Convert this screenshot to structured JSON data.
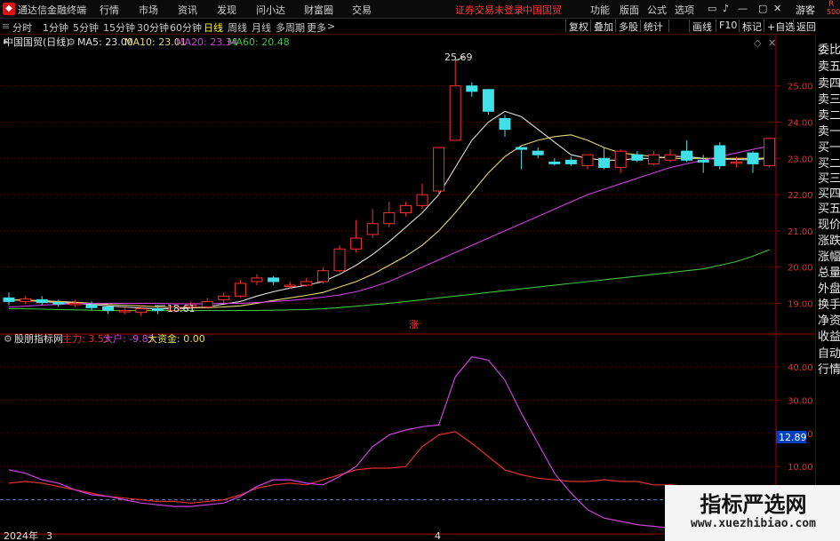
{
  "app": {
    "title": "通达信金融终端",
    "menu": [
      "行情",
      "市场",
      "资讯",
      "发现",
      "问小达",
      "财富圈",
      "交易"
    ],
    "notice": "证券交易未登录",
    "stock_name": "中国国贸",
    "right_menu": [
      "功能",
      "版面",
      "公式",
      "选项"
    ],
    "guest": "游客",
    "corner_top": "R",
    "corner_bottom": "500"
  },
  "periods": {
    "items": [
      "分时",
      "1分钟",
      "5分钟",
      "15分钟",
      "30分钟",
      "60分钟",
      "日线",
      "周线",
      "月线",
      "多周期",
      "更多"
    ],
    "active": "日线"
  },
  "toolbar": [
    "复权",
    "叠加",
    "多股",
    "统计",
    "画线",
    "F10",
    "标记",
    "+自选",
    "返回"
  ],
  "side_panel": [
    "委比",
    "卖五",
    "卖四",
    "卖三",
    "卖二",
    "卖一",
    "买一",
    "买二",
    "买三",
    "买四",
    "买五",
    "现价",
    "涨跌",
    "涨幅",
    "总量",
    "外盘",
    "换手",
    "净资",
    "收益",
    "自动",
    "行情"
  ],
  "main_legend": {
    "title": "中国国贸(日线)",
    "items": [
      {
        "label": "MA5: 23.00",
        "color": "#e0e0e0"
      },
      {
        "label": "MA10: 23.01",
        "color": "#e8d870"
      },
      {
        "label": "MA20: 23.34",
        "color": "#d040e0"
      },
      {
        "label": "MA60: 20.48",
        "color": "#40c040"
      }
    ],
    "high_label": "25.69",
    "low_label": "18.61",
    "rise_mark": "涨"
  },
  "sub_legend": {
    "title": "股朋指标网",
    "items": [
      {
        "label": "主力: 3.53",
        "color": "#e03030"
      },
      {
        "label": "大户: -9.83",
        "color": "#d040e0"
      },
      {
        "label": "大资金: 0.00",
        "color": "#e8e040"
      }
    ],
    "current_value": "12.89"
  },
  "time_axis": {
    "year": "2024年",
    "labels": [
      "3",
      "4"
    ]
  },
  "watermark": {
    "line1": "指标严选网",
    "line2": "www.xuezhibiao.com"
  },
  "colors": {
    "up": "#ff3030",
    "down": "#40e0e8",
    "axis": "#a00000"
  },
  "chart_data": [
    {
      "type": "candlestick",
      "title": "中国国贸(日线)",
      "ylim": [
        18.3,
        25.9
      ],
      "yticks": [
        19.0,
        20.0,
        21.0,
        22.0,
        23.0,
        24.0,
        25.0
      ],
      "candles": [
        [
          19.15,
          19.05,
          19.3,
          18.95
        ],
        [
          19.05,
          19.12,
          19.2,
          18.98
        ],
        [
          19.1,
          19.02,
          19.2,
          18.95
        ],
        [
          19.02,
          18.98,
          19.1,
          18.9
        ],
        [
          18.98,
          19.0,
          19.1,
          18.9
        ],
        [
          18.95,
          18.88,
          19.05,
          18.8
        ],
        [
          18.9,
          18.8,
          18.95,
          18.7
        ],
        [
          18.8,
          18.8,
          18.9,
          18.7
        ],
        [
          18.75,
          18.85,
          18.95,
          18.65
        ],
        [
          18.85,
          18.8,
          18.95,
          18.7
        ],
        [
          18.8,
          18.9,
          18.98,
          18.75
        ],
        [
          18.9,
          18.95,
          19.05,
          18.85
        ],
        [
          18.9,
          19.05,
          19.15,
          18.85
        ],
        [
          19.1,
          19.2,
          19.3,
          19.0
        ],
        [
          19.2,
          19.55,
          19.65,
          19.15
        ],
        [
          19.6,
          19.7,
          19.8,
          19.5
        ],
        [
          19.7,
          19.6,
          19.75,
          19.5
        ],
        [
          19.5,
          19.5,
          19.6,
          19.4
        ],
        [
          19.5,
          19.6,
          19.7,
          19.45
        ],
        [
          19.6,
          19.9,
          20.0,
          19.55
        ],
        [
          19.9,
          20.5,
          20.6,
          19.85
        ],
        [
          20.5,
          20.8,
          21.3,
          20.4
        ],
        [
          20.9,
          21.2,
          21.6,
          20.8
        ],
        [
          21.2,
          21.5,
          21.8,
          21.1
        ],
        [
          21.5,
          21.7,
          21.8,
          21.4
        ],
        [
          21.7,
          22.0,
          22.3,
          21.6
        ],
        [
          22.1,
          23.3,
          23.3,
          22.0
        ],
        [
          23.5,
          25.0,
          25.7,
          23.7
        ],
        [
          25.0,
          24.85,
          25.1,
          24.7
        ],
        [
          24.9,
          24.3,
          24.6,
          24.2
        ],
        [
          24.1,
          23.8,
          24.2,
          23.6
        ],
        [
          23.3,
          23.25,
          23.3,
          22.7
        ],
        [
          23.2,
          23.1,
          23.3,
          23.0
        ],
        [
          22.9,
          22.85,
          23.0,
          22.8
        ],
        [
          22.95,
          22.85,
          23.05,
          22.8
        ],
        [
          22.8,
          23.1,
          23.1,
          22.7
        ],
        [
          23.0,
          22.75,
          23.3,
          22.7
        ],
        [
          22.75,
          23.2,
          23.25,
          22.6
        ],
        [
          23.1,
          22.95,
          23.2,
          22.9
        ],
        [
          22.85,
          23.1,
          23.2,
          22.8
        ],
        [
          22.95,
          23.1,
          23.25,
          22.9
        ],
        [
          23.2,
          22.95,
          23.5,
          22.9
        ],
        [
          22.95,
          22.9,
          23.1,
          22.6
        ],
        [
          23.35,
          22.8,
          23.45,
          22.7
        ],
        [
          22.9,
          22.9,
          23.05,
          22.75
        ],
        [
          23.15,
          22.85,
          23.2,
          22.6
        ],
        [
          22.8,
          23.55,
          23.55,
          22.75
        ]
      ],
      "series": [
        {
          "name": "MA5",
          "values": [
            19.1,
            19.08,
            19.05,
            19.02,
            19.0,
            18.97,
            18.93,
            18.9,
            18.87,
            18.85,
            18.85,
            18.87,
            18.9,
            18.98,
            19.05,
            19.2,
            19.32,
            19.42,
            19.5,
            19.6,
            19.8,
            20.05,
            20.35,
            20.7,
            21.1,
            21.5,
            22.0,
            22.75,
            23.5,
            24.0,
            24.3,
            24.15,
            23.8,
            23.45,
            23.1,
            23.0,
            22.95,
            22.95,
            23.0,
            23.0,
            23.05,
            23.05,
            23.0,
            22.98,
            22.97,
            22.96,
            23.0
          ]
        },
        {
          "name": "MA10",
          "values": [
            19.1,
            19.09,
            19.07,
            19.05,
            19.03,
            19.0,
            18.97,
            18.95,
            18.93,
            18.9,
            18.88,
            18.88,
            18.88,
            18.9,
            18.93,
            19.0,
            19.08,
            19.15,
            19.22,
            19.3,
            19.45,
            19.6,
            19.8,
            20.05,
            20.3,
            20.6,
            21.0,
            21.5,
            22.05,
            22.6,
            23.05,
            23.35,
            23.5,
            23.6,
            23.65,
            23.5,
            23.3,
            23.15,
            23.1,
            23.05,
            23.0,
            23.0,
            23.0,
            23.0,
            23.0,
            23.0,
            23.01
          ]
        },
        {
          "name": "MA20",
          "values": [
            18.9,
            18.92,
            18.95,
            18.97,
            18.99,
            19.0,
            19.0,
            19.0,
            19.0,
            19.0,
            18.99,
            18.99,
            18.99,
            19.0,
            19.0,
            19.02,
            19.05,
            19.08,
            19.12,
            19.17,
            19.23,
            19.32,
            19.45,
            19.6,
            19.8,
            20.0,
            20.2,
            20.4,
            20.6,
            20.8,
            21.0,
            21.2,
            21.4,
            21.6,
            21.8,
            22.0,
            22.15,
            22.3,
            22.45,
            22.6,
            22.75,
            22.85,
            22.95,
            23.05,
            23.15,
            23.25,
            23.34
          ]
        },
        {
          "name": "MA60",
          "values": [
            18.85,
            18.85,
            18.84,
            18.83,
            18.82,
            18.81,
            18.8,
            18.8,
            18.8,
            18.8,
            18.8,
            18.8,
            18.8,
            18.8,
            18.8,
            18.8,
            18.81,
            18.82,
            18.83,
            18.85,
            18.88,
            18.92,
            18.96,
            19.0,
            19.05,
            19.1,
            19.15,
            19.2,
            19.25,
            19.3,
            19.35,
            19.4,
            19.45,
            19.5,
            19.55,
            19.6,
            19.65,
            19.7,
            19.75,
            19.8,
            19.85,
            19.9,
            19.95,
            20.05,
            20.15,
            20.3,
            20.48
          ]
        }
      ]
    },
    {
      "type": "line",
      "title": "股朋指标网",
      "ylim": [
        -10,
        48
      ],
      "yticks": [
        10.0,
        20.0,
        30.0,
        40.0
      ],
      "series": [
        {
          "name": "主力",
          "values": [
            5,
            5.5,
            5,
            4,
            3,
            2,
            1,
            0.5,
            0,
            -0.5,
            -0.5,
            -1,
            -0.5,
            0,
            1.5,
            3.5,
            4.5,
            5,
            4.5,
            6,
            7.5,
            9,
            9.5,
            9.5,
            10,
            16,
            19.5,
            20.5,
            17,
            13,
            9,
            7.5,
            6.5,
            6,
            5.5,
            5.5,
            6,
            5.5,
            5.5,
            4.5,
            4.5,
            4,
            4,
            3.5,
            3,
            3,
            3.53
          ]
        },
        {
          "name": "大户",
          "values": [
            9,
            8,
            6,
            5,
            3,
            1.5,
            1,
            0,
            -1,
            -1.5,
            -2,
            -2,
            -1.5,
            -1,
            1,
            4,
            6,
            6,
            5,
            4.5,
            7,
            10,
            16,
            19.5,
            21,
            22,
            22.5,
            37,
            43,
            42,
            36,
            26,
            17,
            8,
            2,
            -3,
            -5.5,
            -6.5,
            -7.5,
            -8,
            -8.5,
            -9,
            -9,
            -9.5,
            -9.5,
            -9.7,
            -9.83
          ]
        },
        {
          "name": "大资金",
          "values": [
            0,
            0,
            0,
            0,
            0,
            0,
            0,
            0,
            0,
            0,
            0,
            0,
            0,
            0,
            0,
            0,
            0,
            0,
            0,
            0,
            0,
            0,
            0,
            0,
            0,
            0,
            0,
            0,
            0,
            0,
            0,
            0,
            0,
            0,
            0,
            0,
            0,
            0,
            0,
            0,
            0,
            0,
            0,
            0,
            0,
            0,
            0
          ]
        }
      ]
    }
  ]
}
